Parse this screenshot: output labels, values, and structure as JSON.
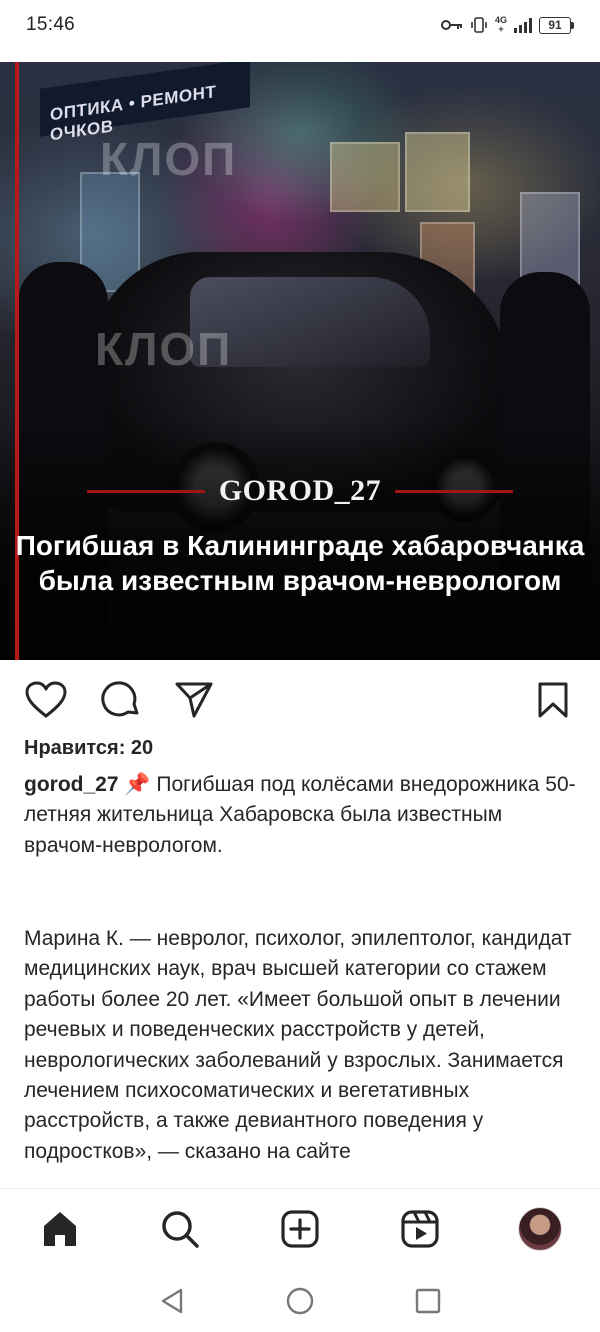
{
  "status_bar": {
    "time": "15:46",
    "network": "4G",
    "network_sub": "+",
    "battery": "91",
    "icons": [
      "key-icon",
      "vibrate-icon",
      "signal-icon",
      "battery-icon"
    ]
  },
  "post": {
    "image": {
      "watermark": "КЛОП",
      "storefront_sign": "ОПТИКА • РЕМОНТ ОЧКОВ",
      "brand": "GOROD_27",
      "headline": "Погибшая в Калининграде хабаровчанка была известным врачом-неврологом"
    },
    "actions": {
      "like_icon": "heart-icon",
      "comment_icon": "comment-icon",
      "share_icon": "send-icon",
      "save_icon": "bookmark-icon"
    },
    "likes_label": "Нравится: 20",
    "username": "gorod_27",
    "pin": "📌",
    "caption_lead": "Погибшая под колёсами внедорожника 50-летняя жительница Хабаровска была известным врачом-неврологом.",
    "body": "Марина К. — невролог, психолог, эпилептолог, кандидат медицинских наук, врач высшей категории со стажем работы более 20 лет. «Имеет большой опыт в лечении речевых и поведенческих расстройств у детей, неврологических заболеваний у взрослых. Занимается лечением психосоматических и вегетативных расстройств, а также девиантного поведения у подростков», — сказано на сайте"
  },
  "bottom_nav": {
    "items": [
      "home-icon",
      "search-icon",
      "create-icon",
      "reels-icon",
      "profile-avatar"
    ]
  },
  "system_nav": [
    "back-icon",
    "home-circle-icon",
    "recents-icon"
  ],
  "colors": {
    "text": "#262626",
    "accent_red": "#a31616",
    "background": "#ffffff"
  }
}
